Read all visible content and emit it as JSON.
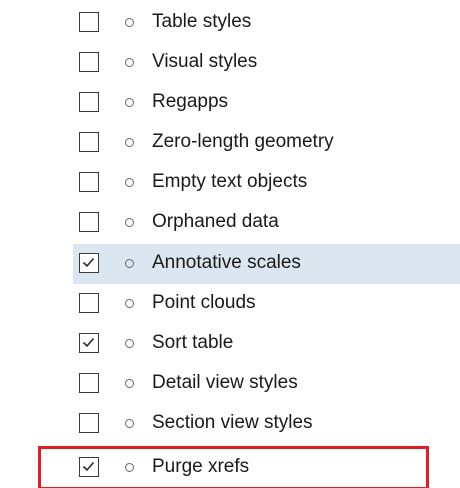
{
  "purge_list": {
    "items": [
      {
        "label": "Table styles",
        "checked": false,
        "selected": false,
        "highlighted": false
      },
      {
        "label": "Visual styles",
        "checked": false,
        "selected": false,
        "highlighted": false
      },
      {
        "label": "Regapps",
        "checked": false,
        "selected": false,
        "highlighted": false
      },
      {
        "label": "Zero-length geometry",
        "checked": false,
        "selected": false,
        "highlighted": false
      },
      {
        "label": "Empty text objects",
        "checked": false,
        "selected": false,
        "highlighted": false
      },
      {
        "label": "Orphaned data",
        "checked": false,
        "selected": false,
        "highlighted": false
      },
      {
        "label": "Annotative scales",
        "checked": true,
        "selected": true,
        "highlighted": false
      },
      {
        "label": "Point clouds",
        "checked": false,
        "selected": false,
        "highlighted": false
      },
      {
        "label": "Sort table",
        "checked": true,
        "selected": false,
        "highlighted": false
      },
      {
        "label": "Detail view styles",
        "checked": false,
        "selected": false,
        "highlighted": false
      },
      {
        "label": "Section view styles",
        "checked": false,
        "selected": false,
        "highlighted": false
      },
      {
        "label": "Purge xrefs",
        "checked": true,
        "selected": false,
        "highlighted": true
      }
    ]
  },
  "colors": {
    "selected_row_bg": "#dce6f0",
    "highlight_outline": "#e31b23"
  }
}
